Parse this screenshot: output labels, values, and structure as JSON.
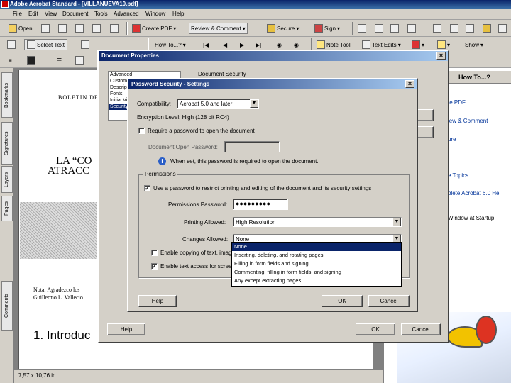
{
  "window": {
    "title": "Adobe Acrobat Standard - [VILLANUEVA10.pdf]"
  },
  "menu": [
    "File",
    "Edit",
    "View",
    "Document",
    "Tools",
    "Advanced",
    "Window",
    "Help"
  ],
  "toolbar1": {
    "open": "Open",
    "create_pdf": "Create PDF",
    "review_comment": "Review & Comment",
    "secure": "Secure",
    "sign": "Sign"
  },
  "toolbar2": {
    "select_text": "Select Text",
    "how_to": "How To...?",
    "note_tool": "Note Tool",
    "text_edits": "Text Edits",
    "show": "Show"
  },
  "nav_tabs": [
    "Bookmarks",
    "Signatures",
    "Layers",
    "Pages",
    "Comments"
  ],
  "document": {
    "heading_small": "BOLETIN DE",
    "title_line1": "LA “CO",
    "title_line2": "ATRACC",
    "note_line1": "Nota: Agradezco los",
    "note_line2": "Guillermo L. Vallecio",
    "section": "1. Introduc"
  },
  "status": {
    "page_size": "7,57 x 10,76 in"
  },
  "howto_panel": {
    "header": "How To...?",
    "links": [
      "te PDF",
      "iew & Comment",
      "ure",
      "e Topics...",
      "plete Acrobat 6.0 He",
      "Window at Startup"
    ]
  },
  "doc_properties": {
    "title": "Document Properties",
    "categories": [
      "Advanced",
      "Custom",
      "Description",
      "Fonts",
      "Initial View",
      "Security"
    ],
    "selected_category": "Security",
    "section_label": "Document Security",
    "help": "Help",
    "ok": "OK",
    "cancel": "Cancel"
  },
  "password_dialog": {
    "title": "Password Security - Settings",
    "compatibility_label": "Compatibility:",
    "compatibility_value": "Acrobat 5.0 and later",
    "encryption_level": "Encryption Level:  High (128 bit RC4)",
    "require_open_password": "Require a password to open the document",
    "open_password_label": "Document Open Password:",
    "open_password_info": "When set, this password is required to open the document.",
    "permissions_group": "Permissions",
    "use_password_restrict": "Use a password to restrict printing and editing of the document and its security settings",
    "permissions_password_label": "Permissions Password:",
    "permissions_password_value": "●●●●●●●●●",
    "printing_allowed_label": "Printing Allowed:",
    "printing_allowed_value": "High Resolution",
    "changes_allowed_label": "Changes Allowed:",
    "changes_allowed_value": "None",
    "enable_copying": "Enable copying of text, images",
    "enable_text_access": "Enable text access for scree",
    "changes_options": [
      "None",
      "Inserting, deleting, and rotating pages",
      "Filling in form fields and signing",
      "Commenting, filling in form fields, and signing",
      "Any except extracting pages"
    ],
    "help": "Help",
    "ok": "OK",
    "cancel": "Cancel"
  }
}
